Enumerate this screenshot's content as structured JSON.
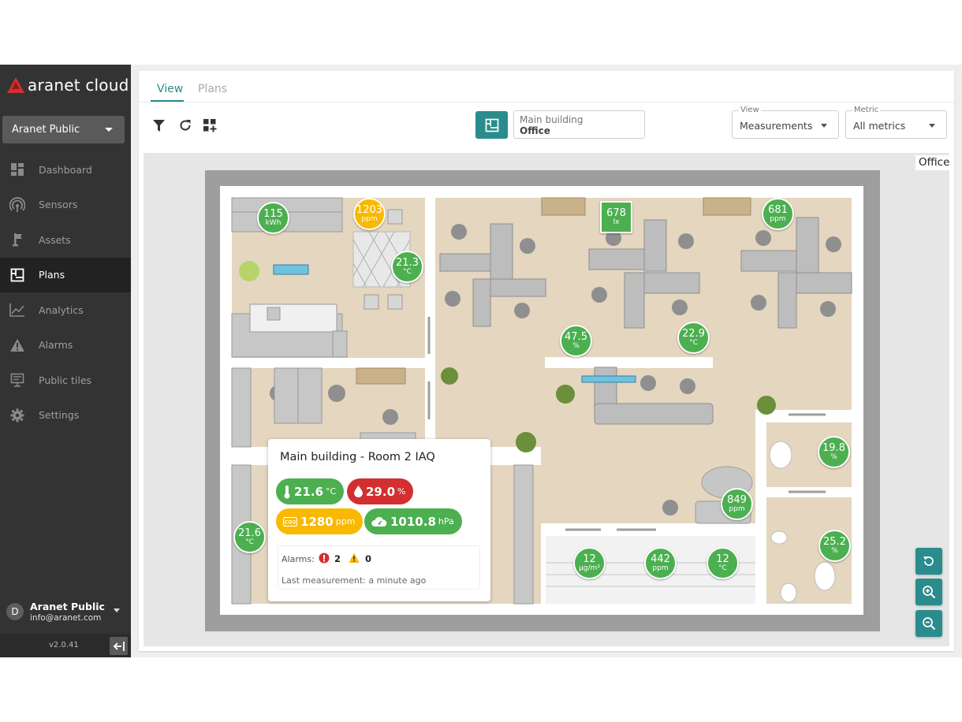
{
  "brand": {
    "name": "aranet cloud",
    "accent": "#2a8c8c",
    "logo_red": "#d32f2f"
  },
  "sidebar": {
    "org_selector": "Aranet Public",
    "items": [
      {
        "label": "Dashboard",
        "icon": "dashboard-icon"
      },
      {
        "label": "Sensors",
        "icon": "sensors-icon"
      },
      {
        "label": "Assets",
        "icon": "assets-icon"
      },
      {
        "label": "Plans",
        "icon": "plans-icon",
        "active": true
      },
      {
        "label": "Analytics",
        "icon": "analytics-icon"
      },
      {
        "label": "Alarms",
        "icon": "alarms-icon"
      },
      {
        "label": "Public tiles",
        "icon": "public-tiles-icon"
      },
      {
        "label": "Settings",
        "icon": "settings-icon"
      }
    ],
    "user": {
      "initial": "D",
      "name": "Aranet Public",
      "email": "info@aranet.com"
    },
    "version": "v2.0.41"
  },
  "tabs": [
    {
      "label": "View",
      "active": true
    },
    {
      "label": "Plans",
      "active": false
    }
  ],
  "toolbar": {
    "location": {
      "building": "Main building",
      "room": "Office"
    },
    "view_dropdown": {
      "label": "View",
      "value": "Measurements"
    },
    "metric_dropdown": {
      "label": "Metric",
      "value": "All metrics"
    }
  },
  "canvas": {
    "room_label": "Office"
  },
  "markers": [
    {
      "value": "115",
      "unit": "kWh",
      "color": "green"
    },
    {
      "value": "1203",
      "unit": "ppm",
      "color": "yellow"
    },
    {
      "value": "21.3",
      "unit": "°C",
      "color": "green"
    },
    {
      "value": "678",
      "unit": "lx",
      "color": "green",
      "shape": "square"
    },
    {
      "value": "681",
      "unit": "ppm",
      "color": "green"
    },
    {
      "value": "47.5",
      "unit": "%",
      "color": "green"
    },
    {
      "value": "22.9",
      "unit": "°C",
      "color": "green"
    },
    {
      "value": "19.8",
      "unit": "%",
      "color": "green"
    },
    {
      "value": "849",
      "unit": "ppm",
      "color": "green"
    },
    {
      "value": "21.6",
      "unit": "°C",
      "color": "green"
    },
    {
      "value": "25.2",
      "unit": "%",
      "color": "green"
    },
    {
      "value": "12",
      "unit": "µg/m³",
      "color": "green"
    },
    {
      "value": "442",
      "unit": "ppm",
      "color": "green"
    },
    {
      "value": "12",
      "unit": "°C",
      "color": "green"
    }
  ],
  "tooltip": {
    "title": "Main building - Room 2 IAQ",
    "chips": [
      {
        "icon": "thermometer-icon",
        "value": "21.6",
        "unit": "°C",
        "color": "green"
      },
      {
        "icon": "humidity-drop-icon",
        "value": "29.0",
        "unit": "%",
        "color": "red"
      },
      {
        "icon": "co2-icon",
        "value": "1280",
        "unit": "ppm",
        "color": "yellow"
      },
      {
        "icon": "pressure-cloud-icon",
        "value": "1010.8",
        "unit": "hPa",
        "color": "green"
      }
    ],
    "alarms_label": "Alarms:",
    "alarms_critical": "2",
    "alarms_warning": "0",
    "last_measurement": "Last measurement: a minute ago"
  },
  "zoom_controls": [
    "reset-view-icon",
    "zoom-in-icon",
    "zoom-out-icon"
  ]
}
